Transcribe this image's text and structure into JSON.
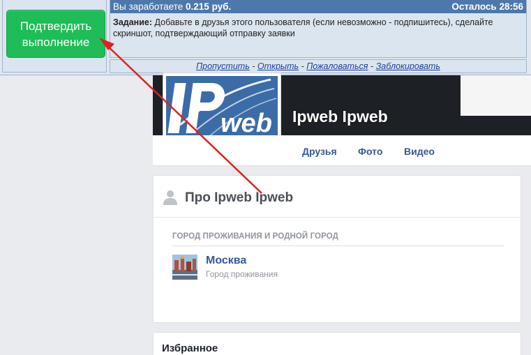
{
  "taskbar": {
    "confirm_button": "Подтвердить выполнение",
    "earn_prefix": "Вы заработаете",
    "earn_amount": "0.215 руб.",
    "time_left": "Осталось 28:56",
    "task_label": "Задание:",
    "task_text": "Добавьте в друзья этого пользователя (если невозможно - подпишитесь), сделайте скриншот, подтверждающий отправку заявки",
    "links": [
      "Пропустить",
      "Открыть",
      "Пожаловаться",
      "Заблокировать"
    ],
    "link_separator": " - "
  },
  "profile": {
    "name": "Ipweb Ipweb",
    "avatar_text": "IPweb",
    "nav": [
      "Друзья",
      "Фото",
      "Видео"
    ]
  },
  "about": {
    "title": "Про Ipweb Ipweb",
    "section_label": "ГОРОД ПРОЖИВАНИЯ И РОДНОЙ ГОРОД",
    "city_name": "Москва",
    "city_sub": "Город проживания"
  },
  "favorites": {
    "title": "Избранное"
  },
  "colors": {
    "confirm_green": "#1ebd57",
    "task_header_blue": "#4d78ab",
    "link_blue": "#365899",
    "arrow_red": "#e0201f"
  },
  "icons": [
    "person-icon",
    "avatar-logo",
    "city-thumbnail",
    "red-arrow"
  ]
}
